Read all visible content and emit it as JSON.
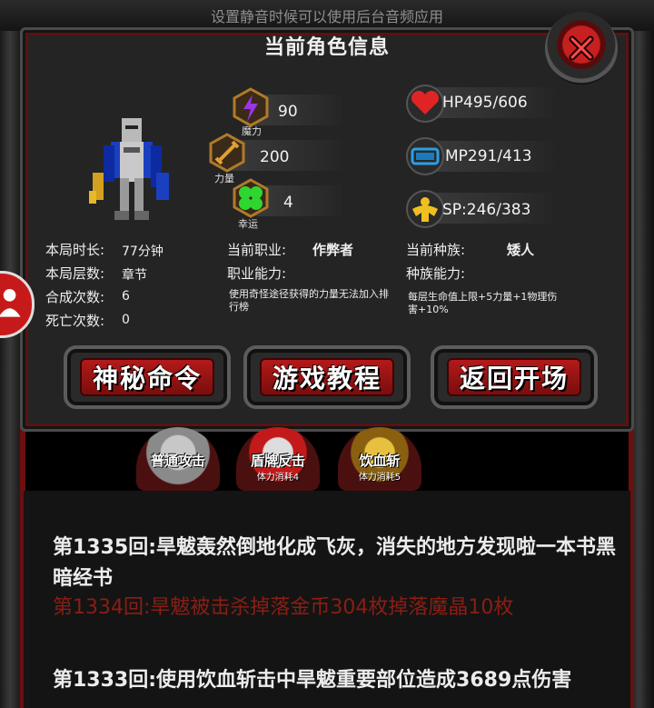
{
  "hint": "设置静音时候可以使用后台音频应用",
  "title": "当前角色信息",
  "stats_left": [
    {
      "label": "魔力",
      "value": "90",
      "icon": "lightning-icon",
      "color": "#8c2bd6"
    },
    {
      "label": "力量",
      "value": "200",
      "icon": "sword-icon",
      "color": "#c88a1a"
    },
    {
      "label": "幸运",
      "value": "4",
      "icon": "clover-icon",
      "color": "#2fc22f"
    }
  ],
  "stats_right": [
    {
      "value": "HP495/606",
      "icon": "heart-icon",
      "color": "#d62020"
    },
    {
      "value": "MP291/413",
      "icon": "mana-potion-icon",
      "color": "#1e8fd6"
    },
    {
      "value": "SP:246/383",
      "icon": "strength-icon",
      "color": "#e0b81a"
    }
  ],
  "info": {
    "time_label": "本局时长:",
    "time_value": "77分钟",
    "floor_label": "本局层数:",
    "floor_value": "章节",
    "craft_label": "合成次数:",
    "craft_value": "6",
    "death_label": "死亡次数:",
    "death_value": "0",
    "job_label": "当前职业:",
    "job_value": "作弊者",
    "job_ability_label": "职业能力:",
    "job_ability_desc": "使用奇怪途径获得的力量无法加入排行榜",
    "race_label": "当前种族:",
    "race_value": "矮人",
    "race_ability_label": "种族能力:",
    "race_ability_desc": "每层生命值上限+5力量+1物理伤害+10%"
  },
  "buttons": [
    "神秘命令",
    "游戏教程",
    "返回开场"
  ],
  "skills": [
    {
      "name": "普通攻击",
      "cost": ""
    },
    {
      "name": "盾牌反击",
      "cost": "体力消耗4"
    },
    {
      "name": "饮血斩",
      "cost": "体力消耗5"
    }
  ],
  "log": [
    {
      "text": "第1335回:旱魃轰然倒地化成飞灰，消失的地方发现啦一本书黑暗经书",
      "style": "white"
    },
    {
      "text": "第1334回:旱魃被击杀掉落金币304枚掉落魔晶10枚",
      "style": "red"
    },
    {
      "text": "第1333回:使用饮血斩击中旱魃重要部位造成3689点伤害",
      "style": "white"
    }
  ]
}
